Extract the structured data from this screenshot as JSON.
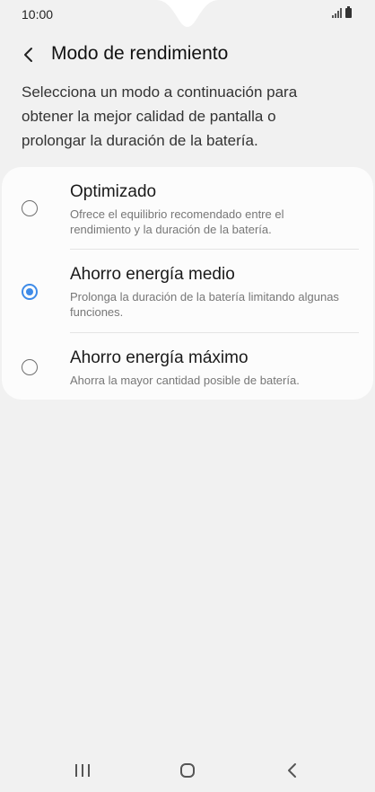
{
  "status_bar": {
    "time": "10:00",
    "signal_icon": "signal-icon",
    "battery_icon": "battery-icon"
  },
  "header": {
    "back_icon": "chevron-left-icon",
    "title": "Modo de rendimiento"
  },
  "description": "Selecciona un modo a continuación para obtener la mejor calidad de pantalla o prolongar la duración de la batería.",
  "options": [
    {
      "title": "Optimizado",
      "description": "Ofrece el equilibrio recomendado entre el rendimiento y la duración de la batería.",
      "selected": false
    },
    {
      "title": "Ahorro energía medio",
      "description": "Prolonga la duración de la batería limitando algunas funciones.",
      "selected": true
    },
    {
      "title": "Ahorro energía máximo",
      "description": "Ahorra la mayor cantidad posible de batería.",
      "selected": false
    }
  ],
  "colors": {
    "accent": "#3e8be8",
    "background": "#f1f1f1",
    "card": "#fcfcfc"
  },
  "nav_bar": {
    "recents_icon": "recents-icon",
    "home_icon": "home-icon",
    "back_icon": "back-icon"
  }
}
